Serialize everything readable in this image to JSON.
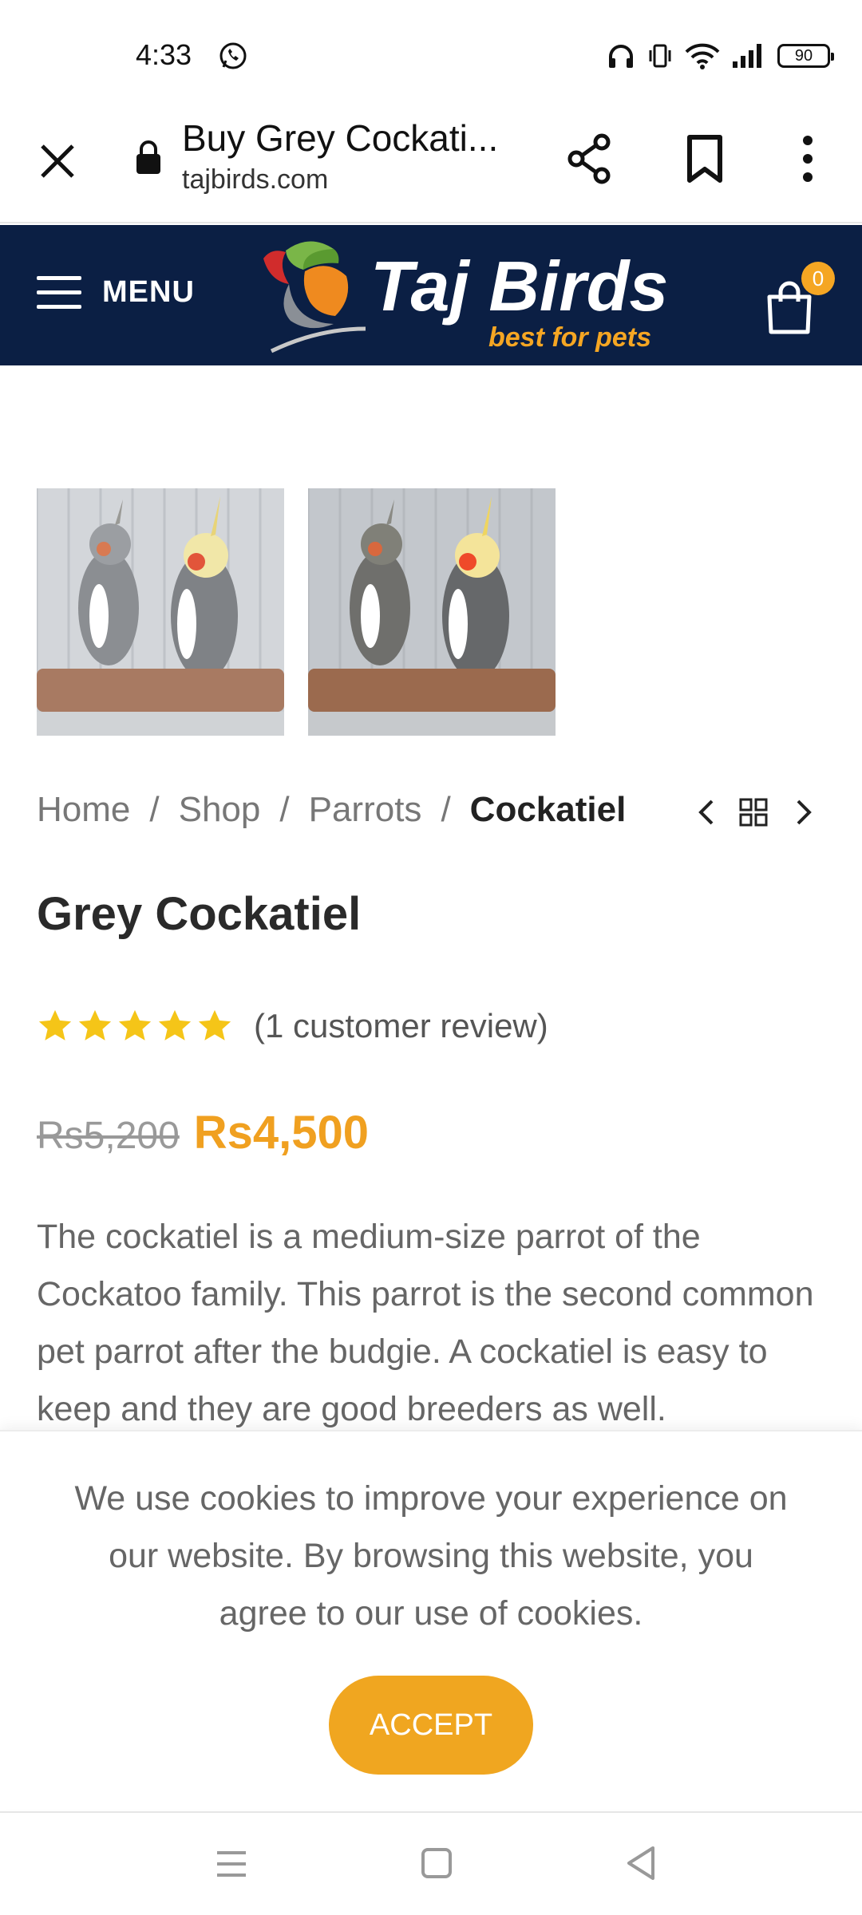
{
  "status_bar": {
    "time": "4:33",
    "battery": "90",
    "icons": [
      "whatsapp-icon",
      "headphones-icon",
      "vibrate-icon",
      "wifi-icon",
      "signal-icon",
      "battery-icon"
    ]
  },
  "browser": {
    "tab_title": "Buy Grey Cockati...",
    "url": "tajbirds.com",
    "icons": [
      "close-icon",
      "lock-icon",
      "share-icon",
      "bookmark-icon",
      "more-vert-icon"
    ]
  },
  "header": {
    "menu_label": "MENU",
    "logo_name": "Taj Birds",
    "logo_tagline": "best for pets",
    "cart_count": "0",
    "colors": {
      "background": "#0b1f44",
      "accent": "#f5a623"
    }
  },
  "breadcrumb": {
    "items": [
      "Home",
      "Shop",
      "Parrots"
    ],
    "current": "Cockatiel",
    "separator": "/"
  },
  "product": {
    "title": "Grey Cockatiel",
    "rating": 5,
    "rating_max": 5,
    "review_text": "(1 customer review)",
    "price_old": "Rs5,200",
    "price_new": "Rs4,500",
    "description": "The cockatiel is a medium-size parrot of the Cockatoo family. This parrot is the second common pet parrot after the budgie. A cockatiel is easy to keep and they are good breeders as well."
  },
  "cookie": {
    "message": "We use cookies to improve your experience on our website. By browsing this website, you agree to our use of cookies.",
    "accept_label": "ACCEPT",
    "accept_color": "#f0a620"
  }
}
